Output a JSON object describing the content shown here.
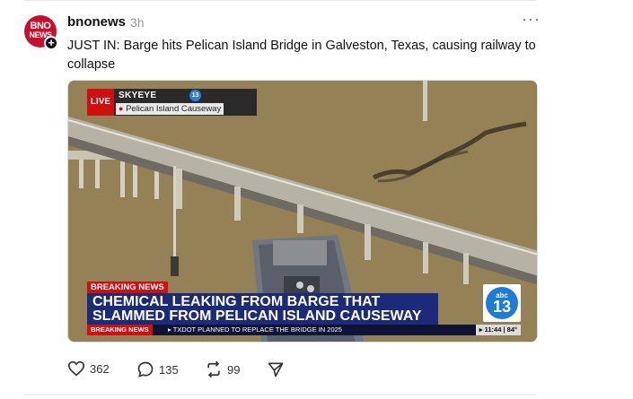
{
  "post": {
    "avatar_line1": "BNO",
    "avatar_line2": "NEWS",
    "follow_symbol": "+",
    "username": "bnonews",
    "time_ago": "3h",
    "more_symbol": "···",
    "text": "JUST IN: Barge hits Pelican Island Bridge in Galveston, Texas, causing railway to collapse"
  },
  "broadcast": {
    "live": "LIVE",
    "skyeye": "SKYEYE",
    "skyeye_badge": "13",
    "location": "Pelican Island Causeway",
    "breaking_label": "BREAKING NEWS",
    "headline_line1": "CHEMICAL LEAKING FROM BARGE THAT",
    "headline_line2": "SLAMMED FROM PELICAN ISLAND CAUSEWAY",
    "station_abc": "abc",
    "station_num": "13",
    "ticker_label": "BREAKING NEWS",
    "ticker_text": "▸ TXDOT PLANNED TO REPLACE THE BRIDGE IN 2025",
    "ticker_status": "▸ 11:44 | 84°"
  },
  "actions": {
    "likes": "362",
    "comments": "135",
    "reposts": "99"
  },
  "icons": [
    "heart-icon",
    "comment-icon",
    "repost-icon",
    "share-icon",
    "pin-icon",
    "plus-icon",
    "more-icon"
  ],
  "colors": {
    "brand_red": "#c8102e",
    "breaking_red": "#d10f0f",
    "headline_blue": "#1c2a7a",
    "abc_blue": "#1e7bd8"
  }
}
